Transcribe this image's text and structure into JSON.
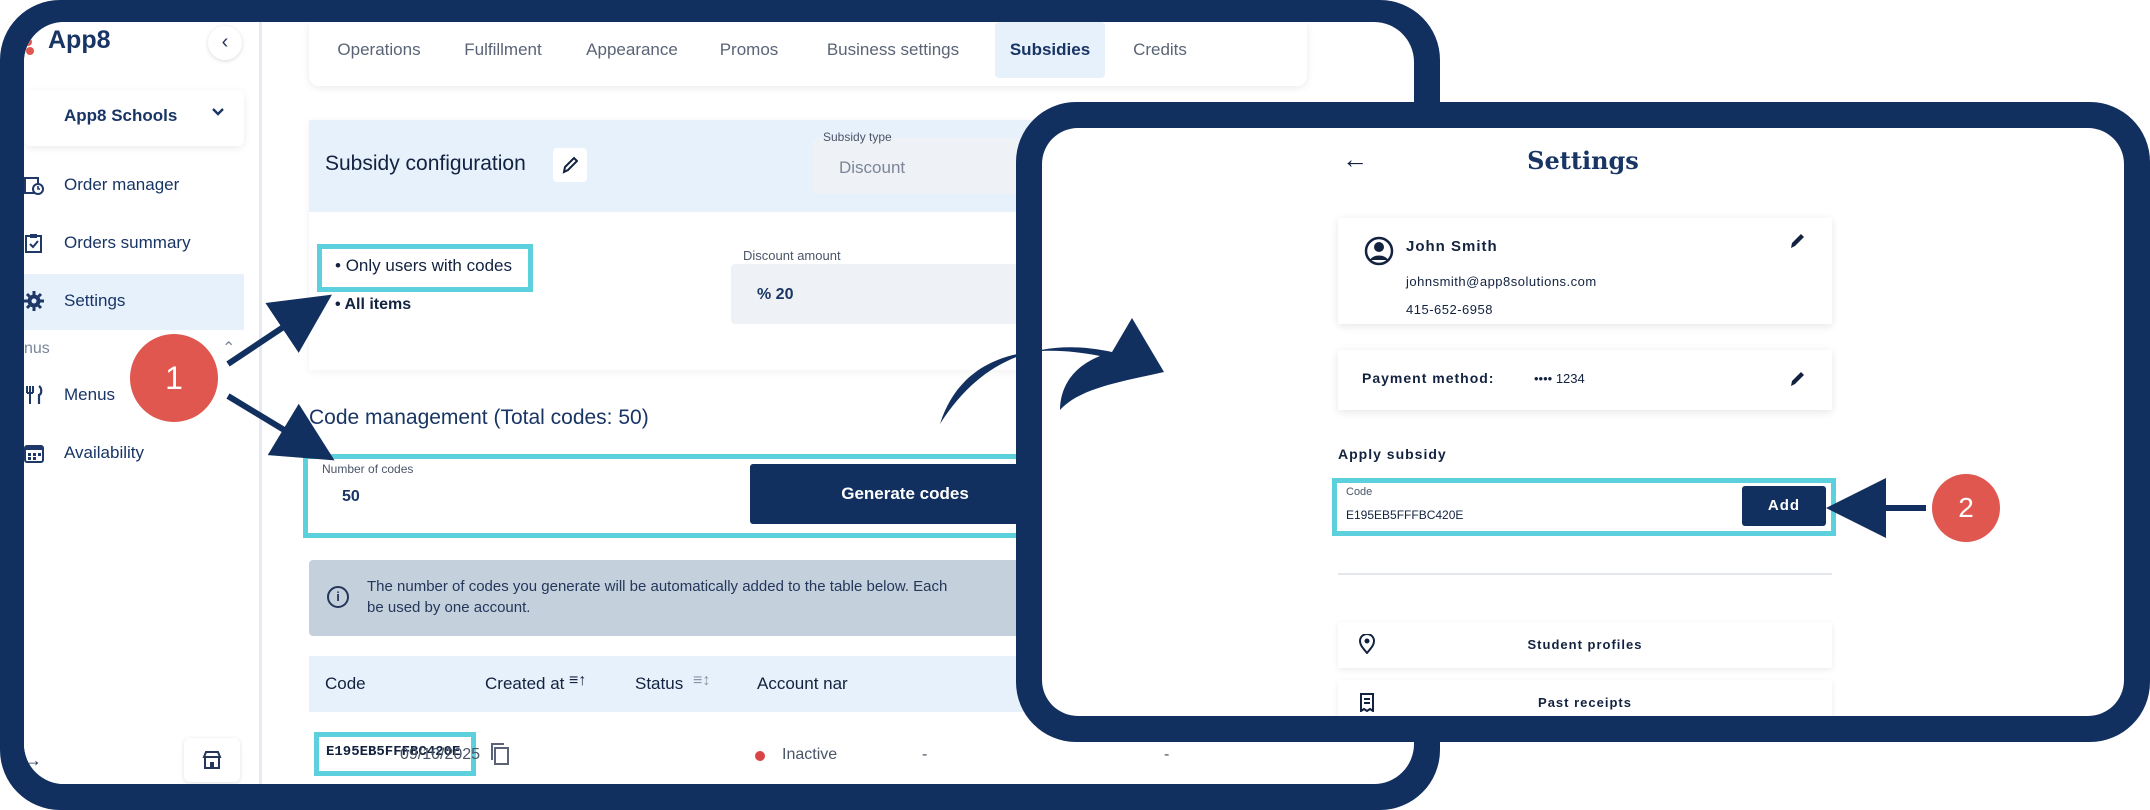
{
  "left": {
    "logo": "App8",
    "collapse_icon": "chevron-left-icon",
    "school_select": {
      "value": "App8 Schools"
    },
    "nav": [
      {
        "label": "Order manager",
        "icon": "clock-icon"
      },
      {
        "label": "Orders summary",
        "icon": "clipboard-icon"
      },
      {
        "label": "Settings",
        "icon": "gear-icon"
      },
      {
        "label": "Menus",
        "icon": "fork-knife-icon"
      },
      {
        "label": "Availability",
        "icon": "calendar-icon"
      }
    ],
    "section_label": "nus",
    "tabs": [
      "Operations",
      "Fulfillment",
      "Appearance",
      "Promos",
      "Business settings",
      "Subsidies",
      "Credits"
    ],
    "active_tab": "Subsidies",
    "config": {
      "title": "Subsidy configuration",
      "subsidy_type_label": "Subsidy type",
      "subsidy_type_value": "Discount",
      "rule_users": "Only users with codes",
      "rule_items": "All items",
      "discount_label": "Discount amount",
      "discount_value": "% 20"
    },
    "code_mgmt_title": "Code management (Total codes: 50)",
    "num_codes_label": "Number of codes",
    "num_codes_value": "50",
    "generate_button": "Generate codes",
    "info_text": "The number of codes you generate will be automatically added to the table below. Each\nbe used by one account.",
    "table": {
      "headers": [
        "Code",
        "Created at",
        "Status",
        "Account nar"
      ],
      "row": {
        "code": "E195EB5FFFBC420E",
        "created": "09/10/2025",
        "status": "Inactive",
        "account": "-",
        "extra": "-"
      }
    }
  },
  "right": {
    "title": "Settings",
    "back_icon": "arrow-left-icon",
    "profile": {
      "name": "John Smith",
      "email": "johnsmith@app8solutions.com",
      "phone": "415-652-6958"
    },
    "payment_label": "Payment method:",
    "payment_digits": "•••• 1234",
    "apply_label": "Apply subsidy",
    "code_label": "Code",
    "code_value": "E195EB5FFFBC420E",
    "add_button": "Add",
    "menu_items": [
      "Student profiles",
      "Past receipts"
    ]
  },
  "badges": [
    "1",
    "2"
  ],
  "colors": {
    "navy": "#12305f",
    "highlight": "#5cd1dd",
    "badge": "#e0574f",
    "active_bg": "#e7f1fc"
  }
}
